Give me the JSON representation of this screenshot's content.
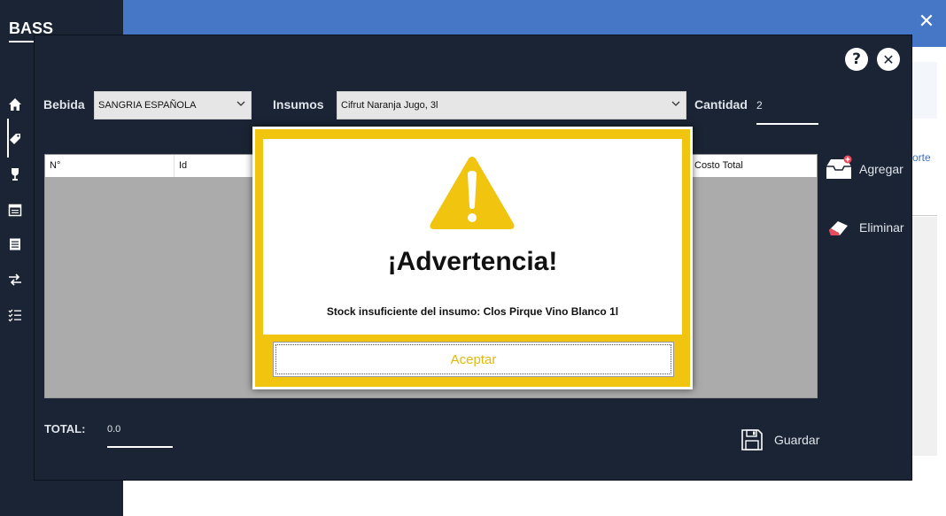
{
  "app": {
    "title": "BASS",
    "bg_link_text": "orte"
  },
  "sidebar": {
    "icons": [
      "home-icon",
      "tag-icon",
      "wine-glass-icon",
      "calendar-icon",
      "list-icon",
      "transfer-icon",
      "checklist-icon"
    ],
    "active_index": 1
  },
  "form": {
    "bebida_label": "Bebida",
    "bebida_value": "SANGRIA ESPAÑOLA",
    "insumos_label": "Insumos",
    "insumos_value": "Cifrut Naranja Jugo, 3l",
    "cantidad_label": "Cantidad",
    "cantidad_value": "2"
  },
  "grid": {
    "columns": [
      "N°",
      "Id",
      "Costo Total"
    ]
  },
  "actions": {
    "agregar": "Agregar",
    "eliminar": "Eliminar",
    "guardar": "Guardar"
  },
  "total": {
    "label": "TOTAL:",
    "value": "0.0"
  },
  "dialog": {
    "title": "¡Advertencia!",
    "message": "Stock insuficiente del insumo: Clos Pirque Vino Blanco 1l",
    "button": "Aceptar"
  },
  "window_buttons": {
    "help": "?",
    "close": "✕",
    "bg_close": "✕"
  },
  "colors": {
    "sidebar": "#1b2434",
    "topbar": "#4677c6",
    "warning": "#f1c40f"
  }
}
